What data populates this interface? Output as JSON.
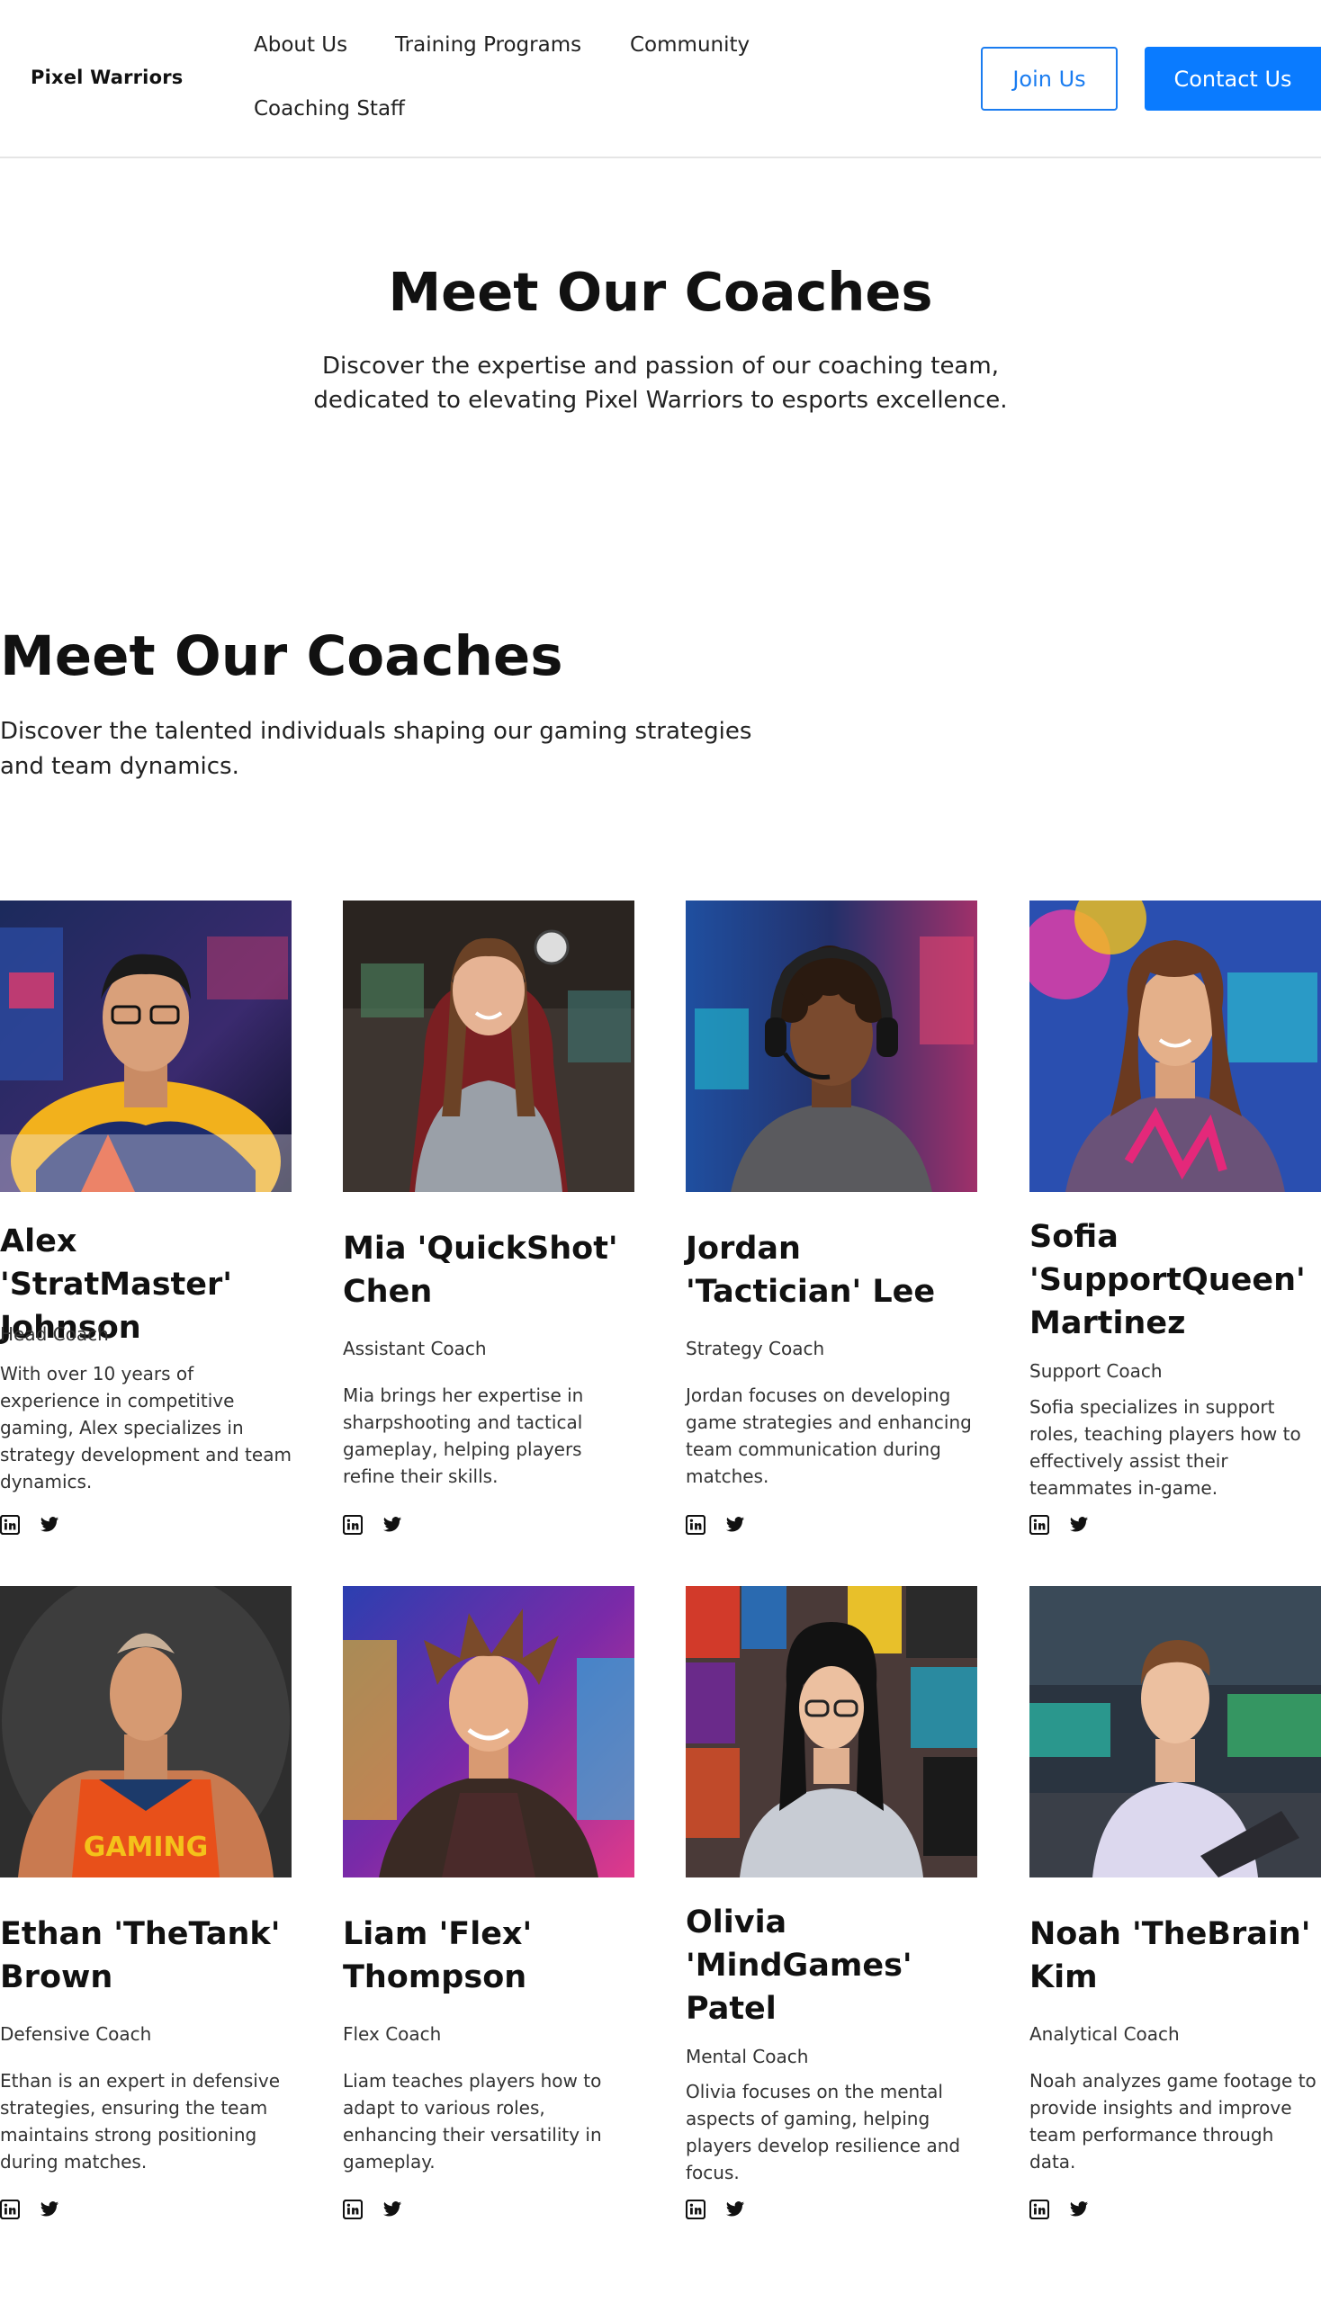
{
  "header": {
    "logo": "Pixel Warriors",
    "nav": [
      "About Us",
      "Training Programs",
      "Community",
      "Coaching Staff"
    ],
    "join_label": "Join Us",
    "contact_label": "Contact Us"
  },
  "hero": {
    "title": "Meet Our Coaches",
    "subtitle": "Discover the expertise and passion of our coaching team, dedicated to elevating Pixel Warriors to esports excellence."
  },
  "section": {
    "title": "Meet Our Coaches",
    "subtitle": "Discover the talented individuals shaping our gaming strategies and team dynamics."
  },
  "coaches": [
    {
      "name": "Alex 'StratMaster' Johnson",
      "role": "Head Coach",
      "bio": "With over 10 years of experience in competitive gaming, Alex specializes in strategy development and team dynamics."
    },
    {
      "name": "Mia 'QuickShot' Chen",
      "role": "Assistant Coach",
      "bio": "Mia brings her expertise in sharpshooting and tactical gameplay, helping players refine their skills."
    },
    {
      "name": "Jordan 'Tactician' Lee",
      "role": "Strategy Coach",
      "bio": "Jordan focuses on developing game strategies and enhancing team communication during matches."
    },
    {
      "name": "Sofia 'SupportQueen' Martinez",
      "role": "Support Coach",
      "bio": "Sofia specializes in support roles, teaching players how to effectively assist their teammates in-game."
    },
    {
      "name": "Ethan 'TheTank' Brown",
      "role": "Defensive Coach",
      "bio": "Ethan is an expert in defensive strategies, ensuring the team maintains strong positioning during matches."
    },
    {
      "name": "Liam 'Flex' Thompson",
      "role": "Flex Coach",
      "bio": "Liam teaches players how to adapt to various roles, enhancing their versatility in gameplay."
    },
    {
      "name": "Olivia 'MindGames' Patel",
      "role": "Mental Coach",
      "bio": "Olivia focuses on the mental aspects of gaming, helping players develop resilience and focus."
    },
    {
      "name": "Noah 'TheBrain' Kim",
      "role": "Analytical Coach",
      "bio": "Noah analyzes game footage to provide insights and improve team performance through data."
    }
  ],
  "icons": {
    "linkedin": "linkedin-icon",
    "twitter": "twitter-icon"
  },
  "colors": {
    "accent": "#0a7bff"
  }
}
